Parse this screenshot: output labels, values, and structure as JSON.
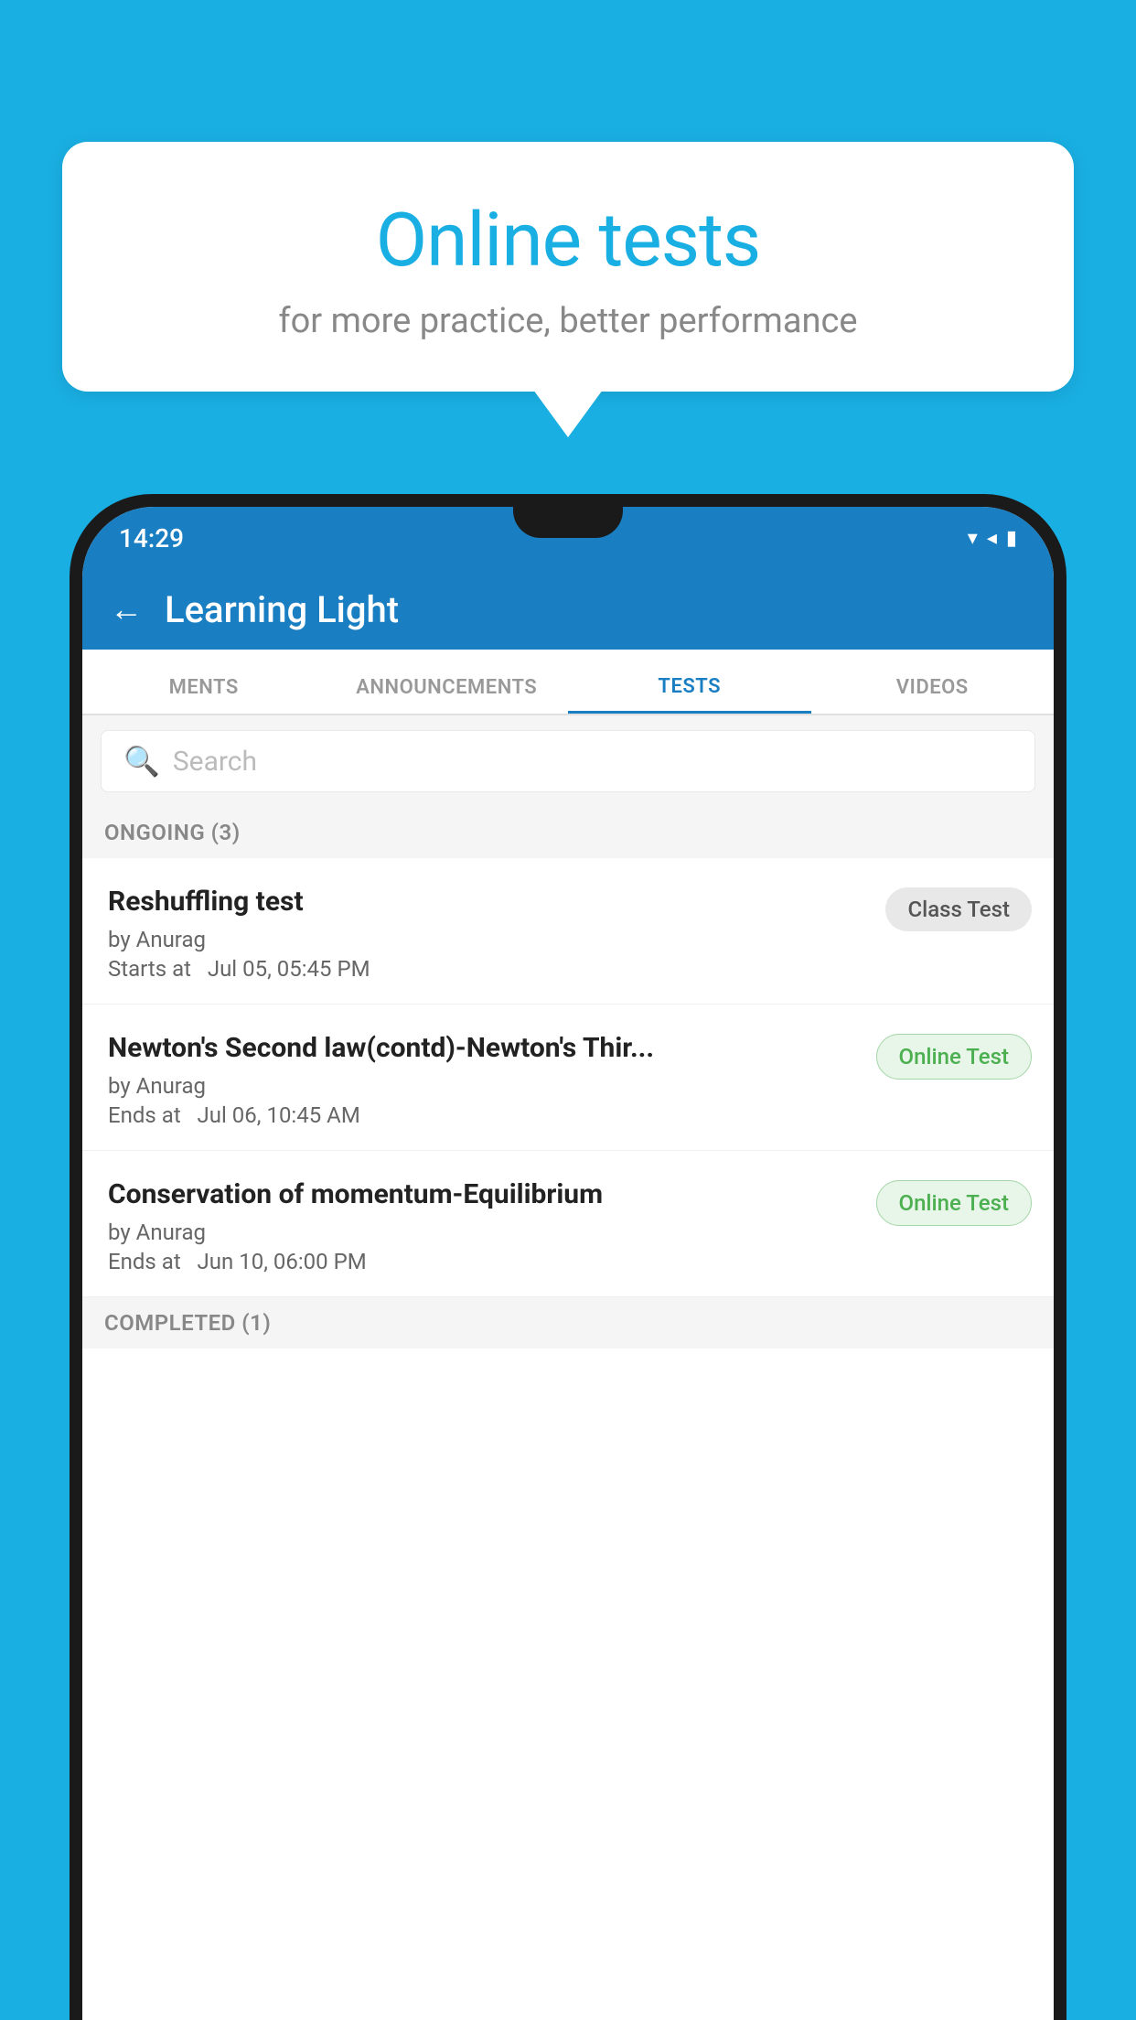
{
  "background": {
    "color": "#1AAFE3"
  },
  "bubble": {
    "title": "Online tests",
    "subtitle": "for more practice, better performance"
  },
  "phone": {
    "status_bar": {
      "time": "14:29",
      "signal_icons": "▾◂▮"
    },
    "app_header": {
      "back_label": "←",
      "title": "Learning Light"
    },
    "tabs": [
      {
        "label": "MENTS",
        "active": false
      },
      {
        "label": "ANNOUNCEMENTS",
        "active": false
      },
      {
        "label": "TESTS",
        "active": true
      },
      {
        "label": "VIDEOS",
        "active": false
      }
    ],
    "search": {
      "placeholder": "Search"
    },
    "sections": [
      {
        "label": "ONGOING (3)",
        "items": [
          {
            "name": "Reshuffling test",
            "author": "by Anurag",
            "date": "Starts at  Jul 05, 05:45 PM",
            "badge": "Class Test",
            "badge_type": "class"
          },
          {
            "name": "Newton's Second law(contd)-Newton's Thir...",
            "author": "by Anurag",
            "date": "Ends at  Jul 06, 10:45 AM",
            "badge": "Online Test",
            "badge_type": "online"
          },
          {
            "name": "Conservation of momentum-Equilibrium",
            "author": "by Anurag",
            "date": "Ends at  Jun 10, 06:00 PM",
            "badge": "Online Test",
            "badge_type": "online"
          }
        ]
      },
      {
        "label": "COMPLETED (1)",
        "items": []
      }
    ]
  }
}
